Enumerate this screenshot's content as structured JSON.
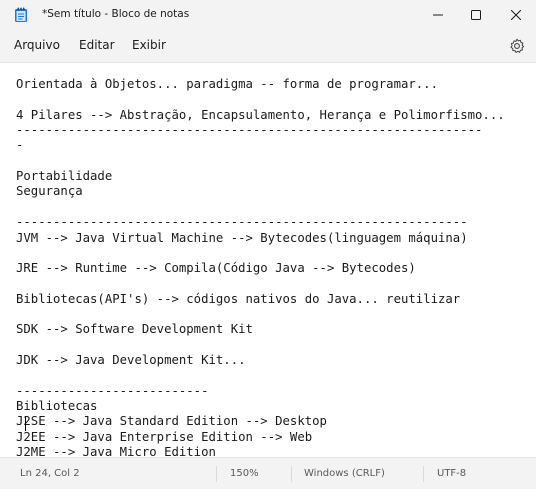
{
  "window": {
    "title": "*Sem título - Bloco de notas",
    "icons": {
      "app": "notepad-icon",
      "minimize": "minimize-icon",
      "maximize": "maximize-icon",
      "close": "close-icon"
    }
  },
  "menu": {
    "items": [
      "Arquivo",
      "Editar",
      "Exibir"
    ],
    "settings_icon": "gear-icon"
  },
  "editor": {
    "lines": [
      "Orientada à Objetos... paradigma -- forma de programar...",
      "4 Pilares --> Abstração, Encapsulamento, Herança e Polimorfismo...",
      "---------------------------------------------------------------",
      "-",
      "Portabilidade",
      "Segurança",
      "-------------------------------------------------------------",
      "JVM --> Java Virtual Machine --> Bytecodes(linguagem máquina)",
      "JRE --> Runtime --> Compila(Código Java --> Bytecodes)",
      "Bibliotecas(API's) --> códigos nativos do Java... reutilizar",
      "SDK --> Software Development Kit",
      "JDK --> Java Development Kit...",
      "--------------------------",
      "Bibliotecas",
      "J2SE --> Java Standard Edition --> Desktop",
      "J2EE --> Java Enterprise Edition --> Web",
      "J2ME --> Java Micro Edition"
    ]
  },
  "status": {
    "position": "Ln 24, Col 2",
    "zoom": "150%",
    "line_ending": "Windows (CRLF)",
    "encoding": "UTF-8"
  }
}
